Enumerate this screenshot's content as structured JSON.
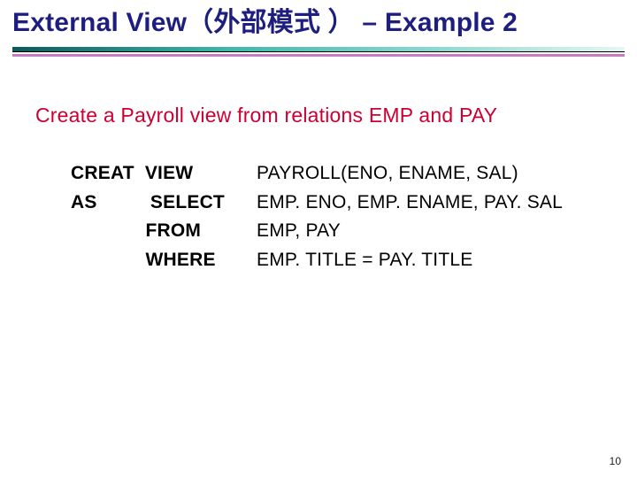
{
  "title": "External View（外部模式 ） – Example 2",
  "subtitle": "Create a Payroll view from relations EMP and PAY",
  "sql": {
    "rows": [
      {
        "kw": "CREAT  VIEW",
        "arg": "PAYROLL(ENO, ENAME, SAL)"
      },
      {
        "kw": "AS          SELECT",
        "arg": "EMP. ENO, EMP. ENAME, PAY. SAL"
      },
      {
        "kw": "              FROM",
        "arg": "EMP, PAY"
      },
      {
        "kw": "              WHERE",
        "arg": "EMP. TITLE = PAY. TITLE"
      }
    ]
  },
  "page_number": "10"
}
